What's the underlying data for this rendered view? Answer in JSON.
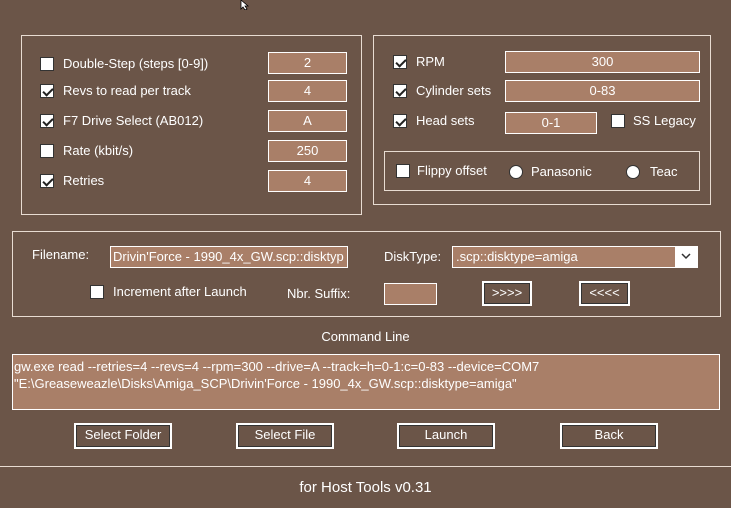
{
  "options": {
    "double_step": {
      "label": "Double-Step (steps [0-9])",
      "checked": false,
      "value": "2"
    },
    "revs": {
      "label": "Revs to read per track",
      "checked": true,
      "value": "4"
    },
    "drive_select": {
      "label": "F7 Drive Select (AB012)",
      "checked": true,
      "value": "A"
    },
    "rate": {
      "label": "Rate (kbit/s)",
      "checked": false,
      "value": "250"
    },
    "retries": {
      "label": "Retries",
      "checked": true,
      "value": "4"
    }
  },
  "drive": {
    "rpm": {
      "label": "RPM",
      "checked": true,
      "value": "300"
    },
    "cylinder_sets": {
      "label": "Cylinder sets",
      "checked": true,
      "value": "0-83"
    },
    "head_sets": {
      "label": "Head sets",
      "checked": true,
      "value": "0-1"
    },
    "ss_legacy": {
      "label": "SS Legacy",
      "checked": false
    },
    "flippy": {
      "label": "Flippy offset",
      "checked": false
    },
    "panasonic": {
      "label": "Panasonic"
    },
    "teac": {
      "label": "Teac"
    }
  },
  "file": {
    "filename_label": "Filename:",
    "filename_value": "Drivin'Force - 1990_4x_GW.scp::disktyp",
    "disktype_label": "DiskType:",
    "disktype_value": ".scp::disktype=amiga",
    "increment_label": "Increment after Launch",
    "increment_checked": false,
    "suffix_label": "Nbr. Suffix:",
    "suffix_value": "",
    "next_label": ">>>>",
    "prev_label": "<<<<"
  },
  "command": {
    "title": "Command Line",
    "text": "gw.exe read --retries=4 --revs=4 --rpm=300 --drive=A --track=h=0-1:c=0-83 --device=COM7 \"E:\\Greaseweazle\\Disks\\Amiga_SCP\\Drivin'Force - 1990_4x_GW.scp::disktype=amiga\""
  },
  "actions": {
    "select_folder": "Select Folder",
    "select_file": "Select File",
    "launch": "Launch",
    "back": "Back"
  },
  "footer": {
    "text": "for Host Tools v0.31"
  },
  "colors": {
    "background": "#6b5548",
    "field": "#a97f68",
    "border": "#ffffff"
  }
}
